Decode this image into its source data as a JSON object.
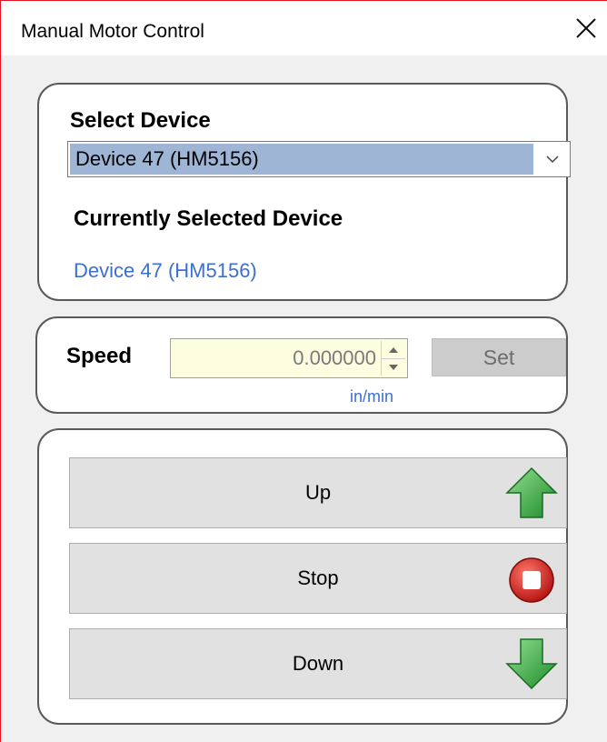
{
  "window": {
    "title": "Manual Motor Control",
    "close_icon": "close-icon"
  },
  "device": {
    "select_label": "Select Device",
    "selected_option": "Device 47 (HM5156)",
    "current_label": "Currently Selected Device",
    "current_value": "Device 47 (HM5156)"
  },
  "speed": {
    "label": "Speed",
    "value": "0.000000",
    "unit": "in/min",
    "set_label": "Set"
  },
  "controls": {
    "up_label": "Up",
    "stop_label": "Stop",
    "down_label": "Down",
    "up_icon": "green-arrow-up-icon",
    "stop_icon": "red-stop-icon",
    "down_icon": "green-arrow-down-icon"
  },
  "colors": {
    "accent_link": "#3b6fd4",
    "selection_bg": "#9fb5d6",
    "input_bg": "#fdfde0",
    "go_green": "#3aa53a",
    "stop_red": "#d62020"
  }
}
